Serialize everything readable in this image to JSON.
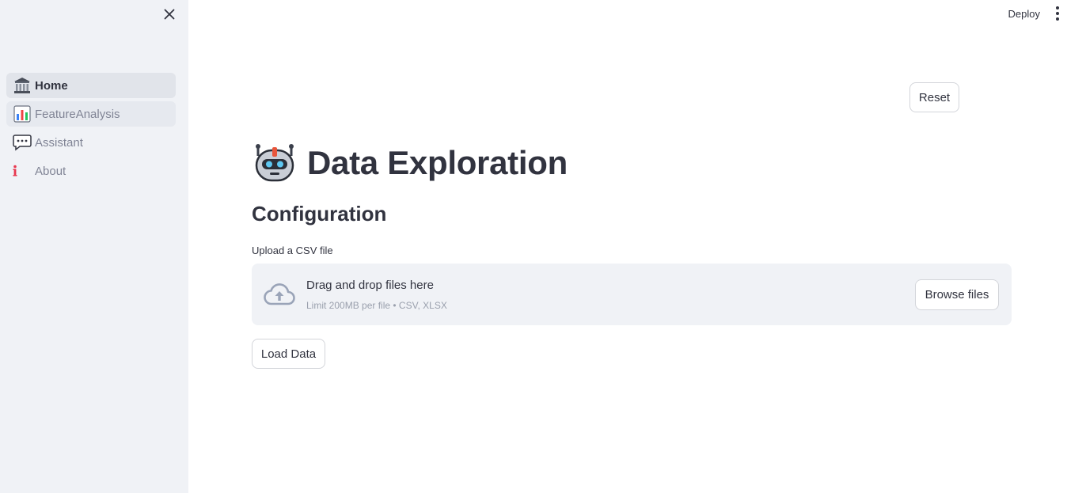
{
  "sidebar": {
    "items": [
      {
        "label": "Home",
        "icon": "classical-building-icon"
      },
      {
        "label": "FeatureAnalysis",
        "icon": "bar-chart-icon"
      },
      {
        "label": "Assistant",
        "icon": "speech-balloon-icon"
      },
      {
        "label": "About",
        "icon": "info-icon"
      }
    ]
  },
  "header": {
    "deploy_label": "Deploy"
  },
  "main": {
    "reset_label": "Reset",
    "title": "Data Exploration",
    "title_icon": "robot-icon",
    "subheader": "Configuration",
    "uploader": {
      "label": "Upload a CSV file",
      "drop_text": "Drag and drop files here",
      "limit_text": "Limit 200MB per file • CSV, XLSX",
      "browse_label": "Browse files"
    },
    "load_label": "Load Data"
  },
  "colors": {
    "sidebar_bg": "#f0f2f6",
    "text": "#31333f",
    "muted": "#808495",
    "info_red": "#e8384f"
  }
}
